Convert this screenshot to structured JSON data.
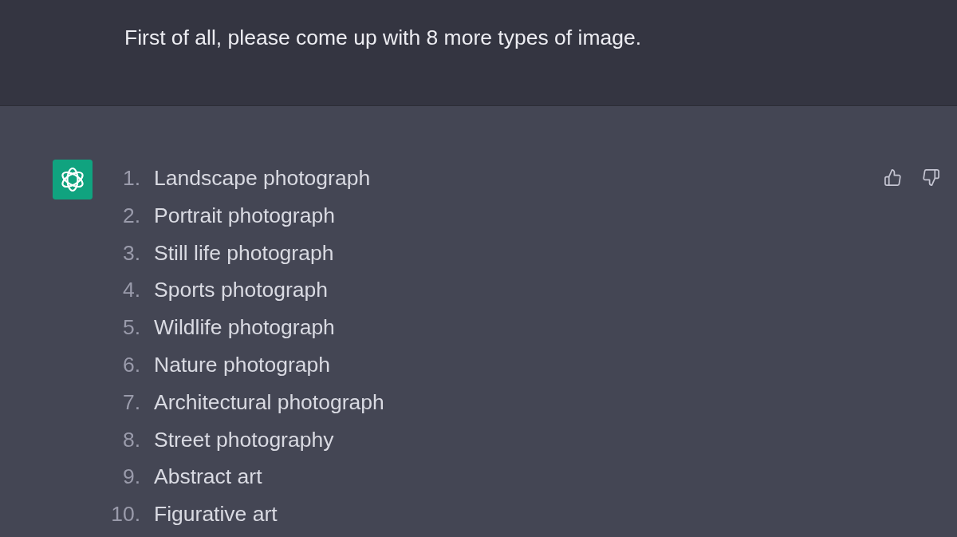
{
  "user_message": {
    "text": "First of all, please come up with 8 more types of image."
  },
  "assistant_message": {
    "items": [
      {
        "number": "1.",
        "text": "Landscape photograph"
      },
      {
        "number": "2.",
        "text": "Portrait photograph"
      },
      {
        "number": "3.",
        "text": "Still life photograph"
      },
      {
        "number": "4.",
        "text": "Sports photograph"
      },
      {
        "number": "5.",
        "text": "Wildlife photograph"
      },
      {
        "number": "6.",
        "text": "Nature photograph"
      },
      {
        "number": "7.",
        "text": "Architectural photograph"
      },
      {
        "number": "8.",
        "text": "Street photography"
      },
      {
        "number": "9.",
        "text": "Abstract art"
      },
      {
        "number": "10.",
        "text": "Figurative art"
      }
    ]
  }
}
